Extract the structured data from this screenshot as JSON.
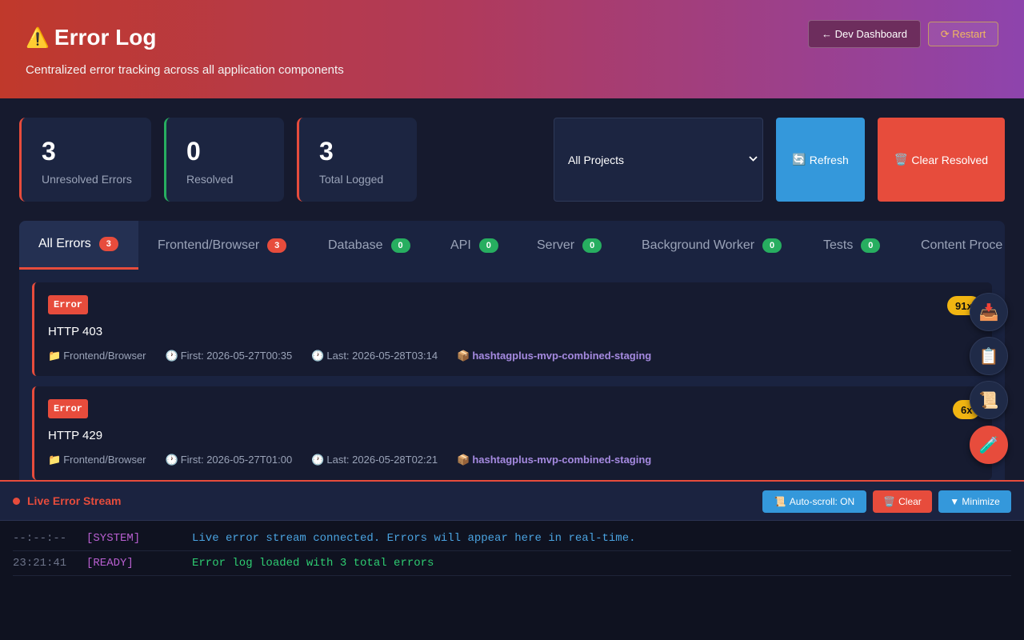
{
  "header": {
    "icon": "warning-icon",
    "title": "Error Log",
    "subtitle": "Centralized error tracking across all application components",
    "dev_dashboard_label": "← Dev Dashboard",
    "restart_label": "⟳ Restart"
  },
  "stats": [
    {
      "value": "3",
      "label": "Unresolved Errors",
      "color": "#e74c3c"
    },
    {
      "value": "0",
      "label": "Resolved",
      "color": "#27ae60"
    },
    {
      "value": "3",
      "label": "Total Logged",
      "color": "#e74c3c"
    }
  ],
  "filters": {
    "project_selected": "All Projects",
    "refresh_label": "Refresh",
    "clear_resolved_label": "Clear Resolved"
  },
  "tabs": [
    {
      "label": "All Errors",
      "count": "3",
      "active": true
    },
    {
      "label": "Frontend/Browser",
      "count": "3"
    },
    {
      "label": "Database",
      "count": "0"
    },
    {
      "label": "API",
      "count": "0"
    },
    {
      "label": "Server",
      "count": "0"
    },
    {
      "label": "Background Worker",
      "count": "0"
    },
    {
      "label": "Tests",
      "count": "0"
    },
    {
      "label": "Content Proce",
      "count": ""
    }
  ],
  "errors": [
    {
      "type": "Error",
      "title": "HTTP 403",
      "category": "Frontend/Browser",
      "first": "First: 2026-05-27T00:35",
      "last": "Last: 2026-05-28T03:14",
      "project": "hashtagplus-mvp-combined-staging",
      "count": "91x"
    },
    {
      "type": "Error",
      "title": "HTTP 429",
      "category": "Frontend/Browser",
      "first": "First: 2026-05-27T01:00",
      "last": "Last: 2026-05-28T02:21",
      "project": "hashtagplus-mvp-combined-staging",
      "count": "6x"
    }
  ],
  "stream": {
    "title": "Live Error Stream",
    "autoscroll_label": "Auto-scroll: ON",
    "clear_label": "Clear",
    "minimize_label": "▼ Minimize",
    "lines": [
      {
        "time": "--:--:--",
        "tag": "[SYSTEM]",
        "message": "Live error stream connected. Errors will appear here in real-time.",
        "color": "#4aa3e0"
      },
      {
        "time": "23:21:41",
        "tag": "[READY]",
        "message": "Error log loaded with 3 total errors",
        "color": "#2ecc71"
      }
    ]
  },
  "colors": {
    "accent_red": "#e74c3c",
    "success_green": "#27ae60",
    "info_blue": "#3498db",
    "warning_yellow": "#f1b512"
  }
}
